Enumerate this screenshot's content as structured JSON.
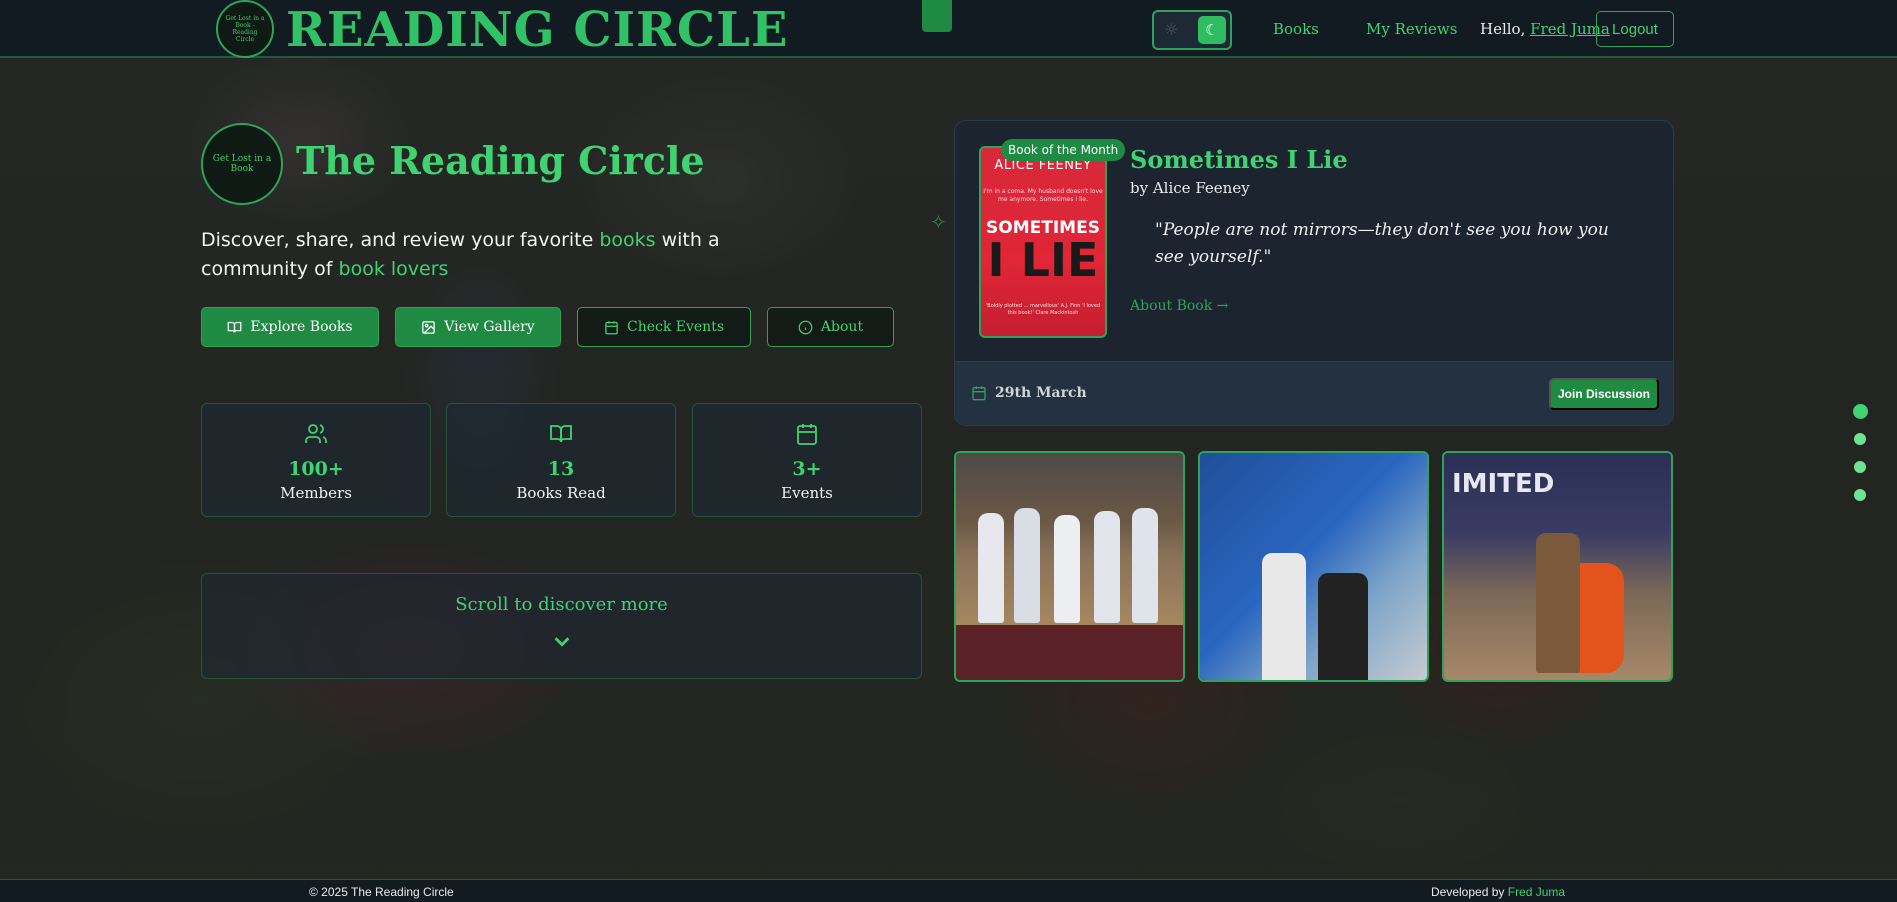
{
  "header": {
    "logo_alt": "Get Lost in a Book - Reading Circle",
    "brand": "READING CIRCLE",
    "nav": {
      "books": "Books",
      "reviews": "My Reviews"
    },
    "greeting": "Hello,",
    "user": "Fred Juma",
    "logout": "Logout",
    "theme_icons": {
      "light": "sun-icon",
      "dark": "moon-icon"
    }
  },
  "hero": {
    "logo_text": "Get Lost in a Book",
    "title": "The Reading Circle",
    "sub": {
      "p1": "Discover, share, and review your favorite ",
      "h1": "books",
      "p2": " with a community of ",
      "h2": "book lovers"
    },
    "buttons": {
      "explore": "Explore Books",
      "gallery": "View Gallery",
      "events": "Check Events",
      "about": "About"
    },
    "stats": [
      {
        "icon": "users-icon",
        "value": "100+",
        "label": "Members"
      },
      {
        "icon": "book-open-icon",
        "value": "13",
        "label": "Books Read"
      },
      {
        "icon": "calendar-icon",
        "value": "3+",
        "label": "Events"
      }
    ],
    "scroll_text": "Scroll to discover more"
  },
  "book_of_month": {
    "badge": "Book of the Month",
    "title": "Sometimes I Lie",
    "author": "by Alice Feeney",
    "quote": "\"People are not mirrors—they don't see you how you see yourself.\"",
    "about_link": "About Book →",
    "date": "29th March",
    "join": "Join Discussion",
    "cover": {
      "author": "ALICE FEENEY",
      "tagline": "I'm in a coma. My husband doesn't love me anymore. Sometimes I lie.",
      "title1": "SOMETIMES",
      "title2": "I LIE",
      "blurb": "'Boldly plotted ... marvellous' A.J. Finn  'I loved this book!' Clare Mackintosh"
    }
  },
  "gallery": {
    "photo3_sign": "IMITED"
  },
  "footer": {
    "copyright": "© 2025 The Reading Circle",
    "dev_label": "Developed by",
    "dev_name": "Fred Juma"
  },
  "colors": {
    "accent": "#3fd372",
    "accent_dark": "#1f8a42",
    "header_bg": "#121a22"
  }
}
